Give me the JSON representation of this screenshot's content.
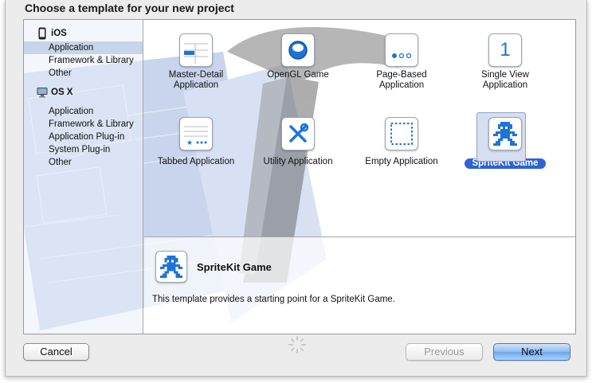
{
  "dialog": {
    "title": "Choose a template for your new project"
  },
  "sidebar": {
    "groups": [
      {
        "platform": "iOS",
        "icon": "iphone-icon",
        "items": [
          "Application",
          "Framework & Library",
          "Other"
        ]
      },
      {
        "platform": "OS X",
        "icon": "mac-icon",
        "items": [
          "Application",
          "Framework & Library",
          "Application Plug-in",
          "System Plug-in",
          "Other"
        ]
      }
    ],
    "selected": "iOS / Application"
  },
  "templates": [
    {
      "label": "Master-Detail\nApplication",
      "icon": "master-detail-icon"
    },
    {
      "label": "OpenGL Game",
      "icon": "opengl-icon"
    },
    {
      "label": "Page-Based\nApplication",
      "icon": "page-based-icon"
    },
    {
      "label": "Single View\nApplication",
      "icon": "single-view-icon",
      "glyph": "1"
    },
    {
      "label": "Tabbed Application",
      "icon": "tabbed-icon"
    },
    {
      "label": "Utility Application",
      "icon": "utility-icon"
    },
    {
      "label": "Empty Application",
      "icon": "empty-icon"
    },
    {
      "label": "SpriteKit Game",
      "icon": "spritekit-icon",
      "selected": true
    }
  ],
  "detail": {
    "title": "SpriteKit Game",
    "description": "This template provides a starting point for a SpriteKit Game.",
    "icon": "spritekit-icon"
  },
  "buttons": {
    "cancel": "Cancel",
    "previous": "Previous",
    "next": "Next"
  },
  "colors": {
    "selection": "#2f62d6",
    "sidebar_selection": "#c7d4ea",
    "icon_blue": "#1f73d6"
  }
}
